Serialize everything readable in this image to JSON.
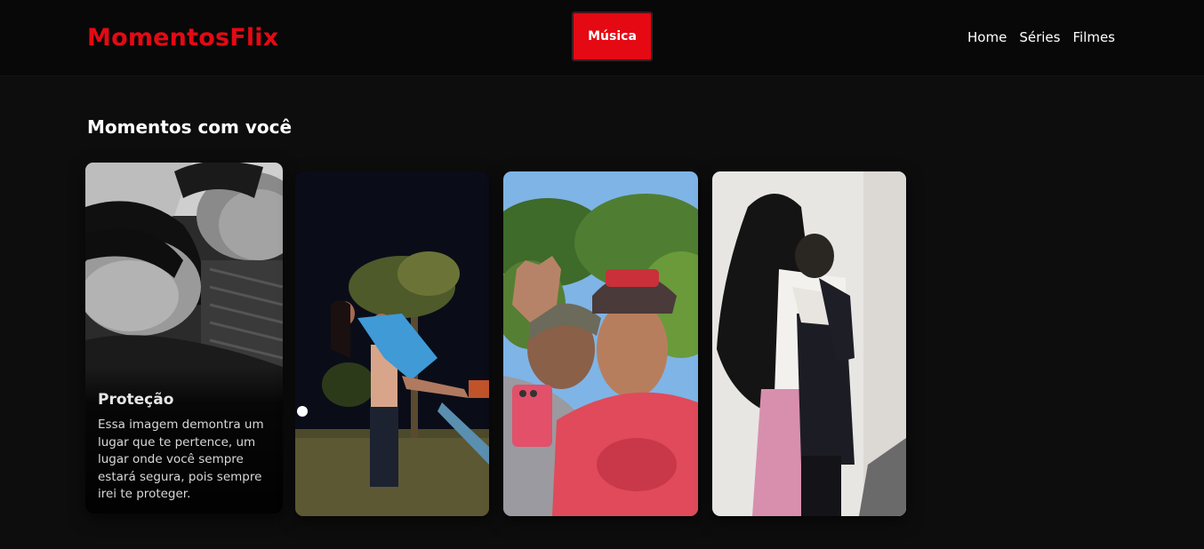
{
  "header": {
    "brand": "MomentosFlix",
    "music_button": "Música",
    "nav": [
      "Home",
      "Séries",
      "Filmes"
    ]
  },
  "section": {
    "title": "Momentos com você"
  },
  "cards": [
    {
      "title": "Proteção",
      "description": "Essa imagem demontra um lugar que te pertence, um lugar onde você sempre estará segura, pois sempre irei te proteger.",
      "image": "couple-selfie-bw-photo"
    },
    {
      "image": "couple-night-park-photo"
    },
    {
      "image": "couple-selfie-trees-photo"
    },
    {
      "image": "couple-hug-photo"
    }
  ],
  "colors": {
    "brand": "#e50914",
    "header_bg": "#080808",
    "page_bg": "#0d0d0d"
  }
}
